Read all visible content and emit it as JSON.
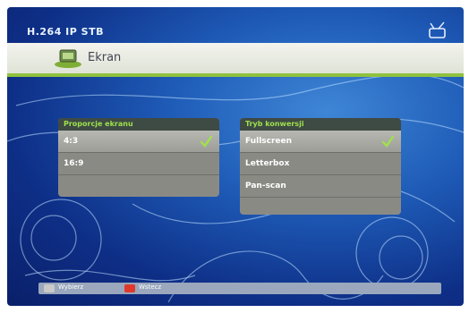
{
  "app": {
    "brand": "H.264 IP STB"
  },
  "header": {
    "title": "Ekran"
  },
  "icons": {
    "header": "screen-settings-icon",
    "tv": "tv-antenna-icon",
    "check": "checkmark-icon"
  },
  "left_panel": {
    "title": "Proporcje ekranu",
    "options": [
      {
        "label": "4:3",
        "selected": true
      },
      {
        "label": "16:9",
        "selected": false
      }
    ]
  },
  "right_panel": {
    "title": "Tryb konwersji",
    "options": [
      {
        "label": "Fullscreen",
        "selected": true
      },
      {
        "label": "Letterbox",
        "selected": false
      },
      {
        "label": "Pan-scan",
        "selected": false
      }
    ]
  },
  "footer": {
    "buttons": [
      {
        "label": "Wybierz",
        "color": "#c9c9c9"
      },
      {
        "label": "Wstecz",
        "color": "#e0392b"
      }
    ]
  },
  "colors": {
    "accent": "#8fc13f",
    "title_text": "#9fe14c",
    "background": "#1e5bb7"
  }
}
